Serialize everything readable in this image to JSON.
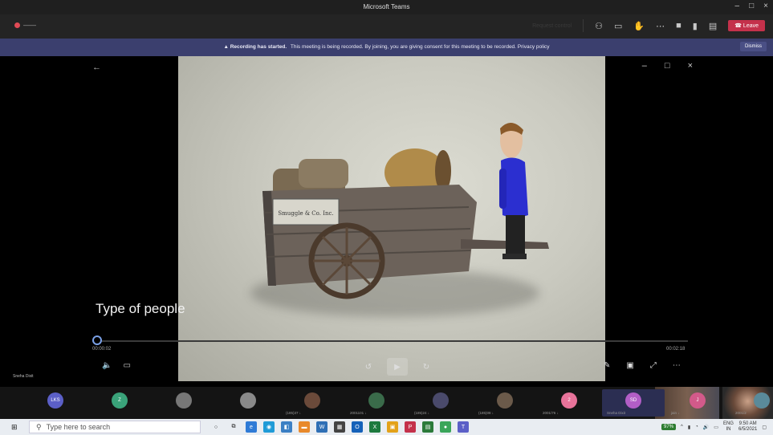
{
  "window": {
    "title": "Microsoft Teams",
    "min": "–",
    "max": "□",
    "close": "×"
  },
  "toolbar": {
    "meeting_name": "——",
    "request_control": "Request control",
    "leave_label": "Leave"
  },
  "banner": {
    "bold": "Recording has started.",
    "text": "This meeting is being recorded. By joining, you are giving consent for this meeting to be recorded. Privacy policy",
    "dismiss": "Dismiss"
  },
  "video": {
    "caption": "Type of people",
    "sign_text": "Smuggle & Co. Inc.",
    "time_current": "00:00:02",
    "time_total": "00:02:18",
    "progress_fraction": 0.0
  },
  "presenter_label": "Sneha Dixit",
  "participants": [
    {
      "initials": "LKS",
      "color": "#5b5fc7",
      "name": ""
    },
    {
      "initials": "Z",
      "color": "#3aa37a",
      "name": ""
    },
    {
      "initials": "",
      "color": "#777777",
      "name": ""
    },
    {
      "initials": "",
      "color": "#8a8a8a",
      "name": ""
    },
    {
      "initials": "",
      "color": "#6b4a3a",
      "name": "(185)37 ↓"
    },
    {
      "initials": "",
      "color": "#3a6b4a",
      "name": "2001101 ↓"
    },
    {
      "initials": "",
      "color": "#4a4a6b",
      "name": "(185)24 ↓"
    },
    {
      "initials": "",
      "color": "#6b5a4a",
      "name": "(185)08 ↓"
    },
    {
      "initials": "2",
      "color": "#e8739a",
      "name": "2001/76 ↓"
    },
    {
      "initials": "SD",
      "color": "#b25ec6",
      "name": "Sneha Dixit"
    },
    {
      "initials": "J",
      "color": "#d25a8a",
      "name": "jain ↓"
    },
    {
      "initials": "",
      "color": "#5a8a9a",
      "name": "2001/2"
    }
  ],
  "taskbar": {
    "search_placeholder": "Type here to search",
    "battery": "97%",
    "lang": "ENG",
    "lang2": "IN",
    "time": "9:50 AM",
    "date": "6/5/2021"
  },
  "colors": {
    "banner": "#3b3f6e",
    "leave": "#c4314b",
    "active_tile": "#2b2e52"
  }
}
